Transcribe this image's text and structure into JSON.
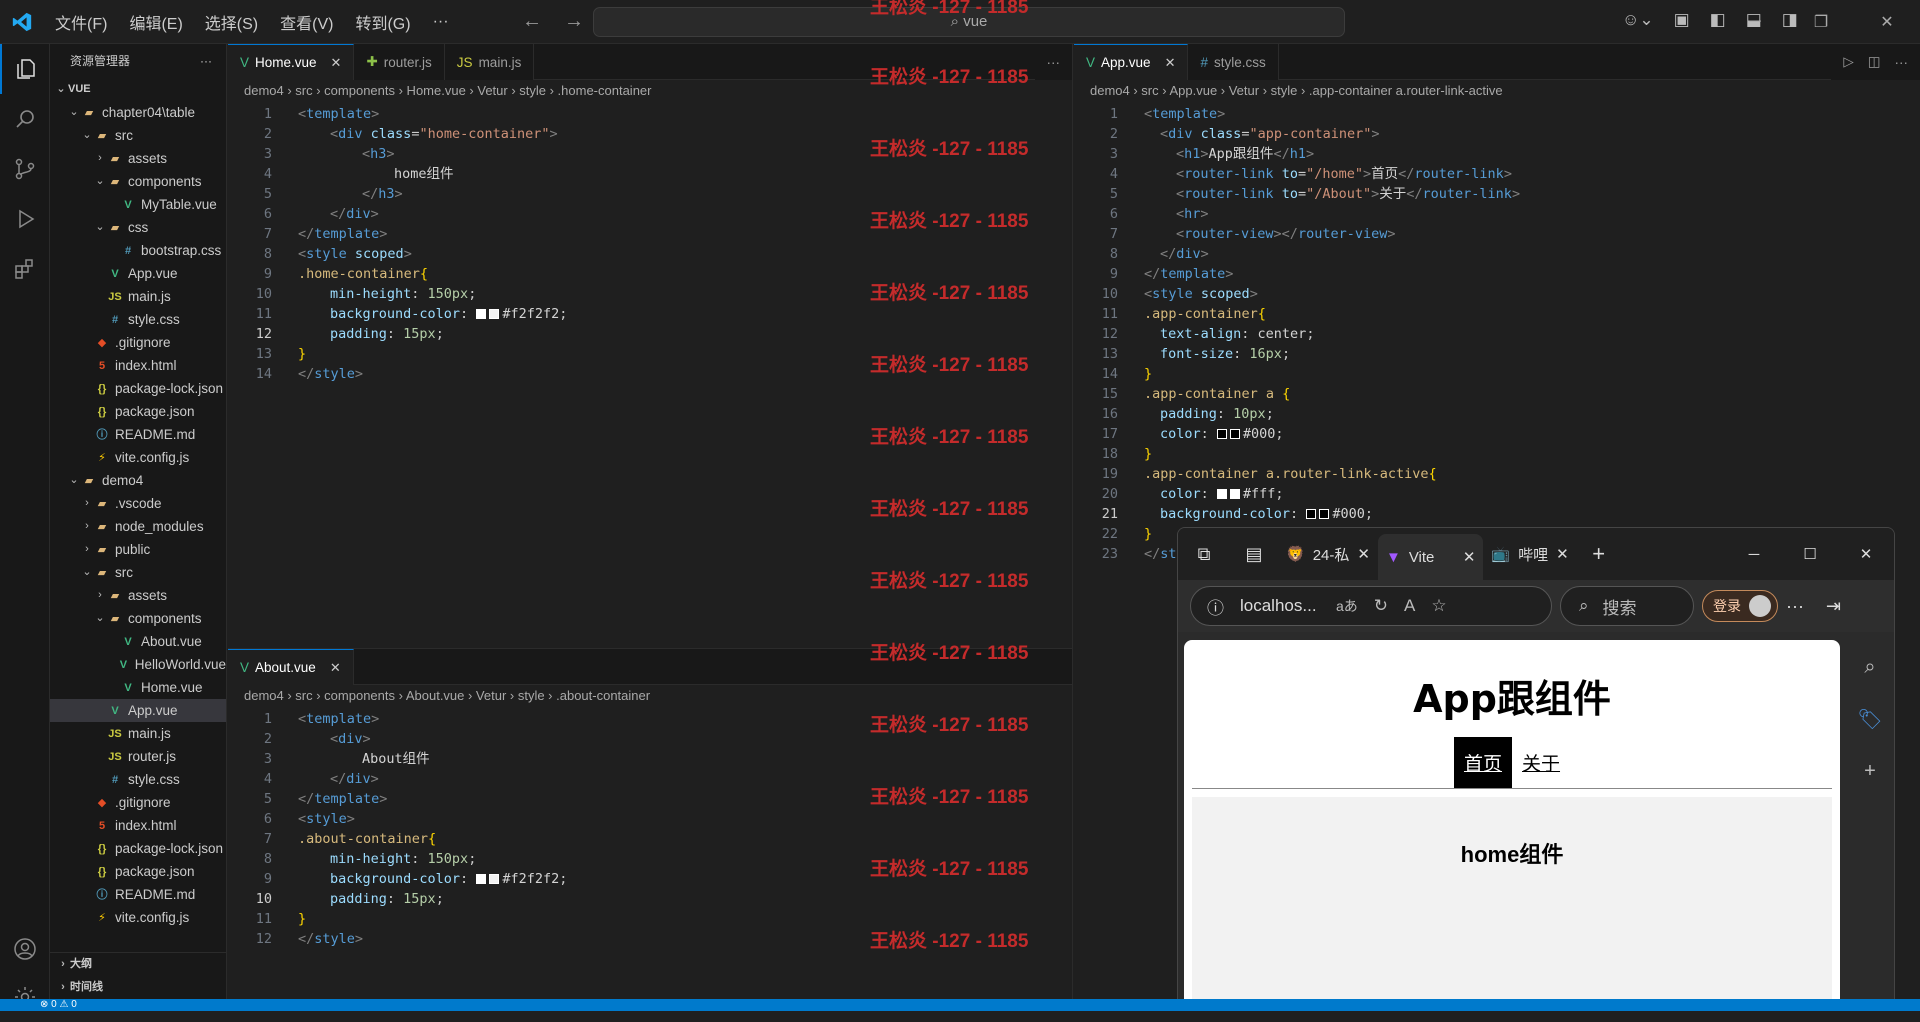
{
  "menu": [
    "文件(F)",
    "编辑(E)",
    "选择(S)",
    "查看(V)",
    "转到(G)",
    "···"
  ],
  "command_search": "vue",
  "colors": {
    "accent": "#0078d4",
    "statusbar": "#007acc",
    "watermark": "#c42b2b"
  },
  "watermark": "王松炎 -127 - 1185",
  "explorer": {
    "title": "资源管理器",
    "root": "VUE",
    "items": [
      {
        "label": "chapter04\\table",
        "depth": 1,
        "type": "folder",
        "open": true
      },
      {
        "label": "src",
        "depth": 2,
        "type": "folder",
        "open": true
      },
      {
        "label": "assets",
        "depth": 3,
        "type": "folder",
        "open": false
      },
      {
        "label": "components",
        "depth": 3,
        "type": "folder",
        "open": true
      },
      {
        "label": "MyTable.vue",
        "depth": 4,
        "type": "vue"
      },
      {
        "label": "css",
        "depth": 3,
        "type": "folder",
        "open": true
      },
      {
        "label": "bootstrap.css",
        "depth": 4,
        "type": "css"
      },
      {
        "label": "App.vue",
        "depth": 3,
        "type": "vue"
      },
      {
        "label": "main.js",
        "depth": 3,
        "type": "js"
      },
      {
        "label": "style.css",
        "depth": 3,
        "type": "css"
      },
      {
        "label": ".gitignore",
        "depth": 2,
        "type": "git"
      },
      {
        "label": "index.html",
        "depth": 2,
        "type": "html"
      },
      {
        "label": "package-lock.json",
        "depth": 2,
        "type": "json"
      },
      {
        "label": "package.json",
        "depth": 2,
        "type": "json"
      },
      {
        "label": "README.md",
        "depth": 2,
        "type": "md"
      },
      {
        "label": "vite.config.js",
        "depth": 2,
        "type": "vite"
      },
      {
        "label": "demo4",
        "depth": 1,
        "type": "folder",
        "open": true
      },
      {
        "label": ".vscode",
        "depth": 2,
        "type": "folder",
        "open": false
      },
      {
        "label": "node_modules",
        "depth": 2,
        "type": "folder",
        "open": false
      },
      {
        "label": "public",
        "depth": 2,
        "type": "folder",
        "open": false
      },
      {
        "label": "src",
        "depth": 2,
        "type": "folder",
        "open": true
      },
      {
        "label": "assets",
        "depth": 3,
        "type": "folder",
        "open": false
      },
      {
        "label": "components",
        "depth": 3,
        "type": "folder",
        "open": true
      },
      {
        "label": "About.vue",
        "depth": 4,
        "type": "vue"
      },
      {
        "label": "HelloWorld.vue",
        "depth": 4,
        "type": "vue"
      },
      {
        "label": "Home.vue",
        "depth": 4,
        "type": "vue"
      },
      {
        "label": "App.vue",
        "depth": 3,
        "type": "vue",
        "selected": true
      },
      {
        "label": "main.js",
        "depth": 3,
        "type": "js"
      },
      {
        "label": "router.js",
        "depth": 3,
        "type": "js"
      },
      {
        "label": "style.css",
        "depth": 3,
        "type": "css"
      },
      {
        "label": ".gitignore",
        "depth": 2,
        "type": "git"
      },
      {
        "label": "index.html",
        "depth": 2,
        "type": "html"
      },
      {
        "label": "package-lock.json",
        "depth": 2,
        "type": "json"
      },
      {
        "label": "package.json",
        "depth": 2,
        "type": "json"
      },
      {
        "label": "README.md",
        "depth": 2,
        "type": "md"
      },
      {
        "label": "vite.config.js",
        "depth": 2,
        "type": "vite"
      }
    ],
    "outline": "大纲",
    "timeline": "时间线"
  },
  "editor_left_top": {
    "tabs": [
      {
        "label": "Home.vue",
        "active": true
      },
      {
        "label": "router.js"
      },
      {
        "label": "main.js"
      }
    ],
    "breadcrumb": "demo4 › src › components › Home.vue › Vetur › style › .home-container"
  },
  "editor_left_bottom": {
    "tabs": [
      {
        "label": "About.vue",
        "active": true
      }
    ],
    "breadcrumb": "demo4 › src › components › About.vue › Vetur › style › .about-container"
  },
  "editor_right": {
    "tabs": [
      {
        "label": "App.vue",
        "active": true
      },
      {
        "label": "style.css"
      }
    ],
    "breadcrumb": "demo4 › src › App.vue › Vetur › style › .app-container a.router-link-active"
  },
  "browser": {
    "tabs": [
      "24-私",
      "Vite",
      "哔哩"
    ],
    "address": "localhos...",
    "search_placeholder": "搜索",
    "login": "登录",
    "page": {
      "heading": "App跟组件",
      "links": [
        "首页",
        "关于"
      ],
      "content": "home组件"
    }
  },
  "status": "⊗ 0 ⚠ 0"
}
